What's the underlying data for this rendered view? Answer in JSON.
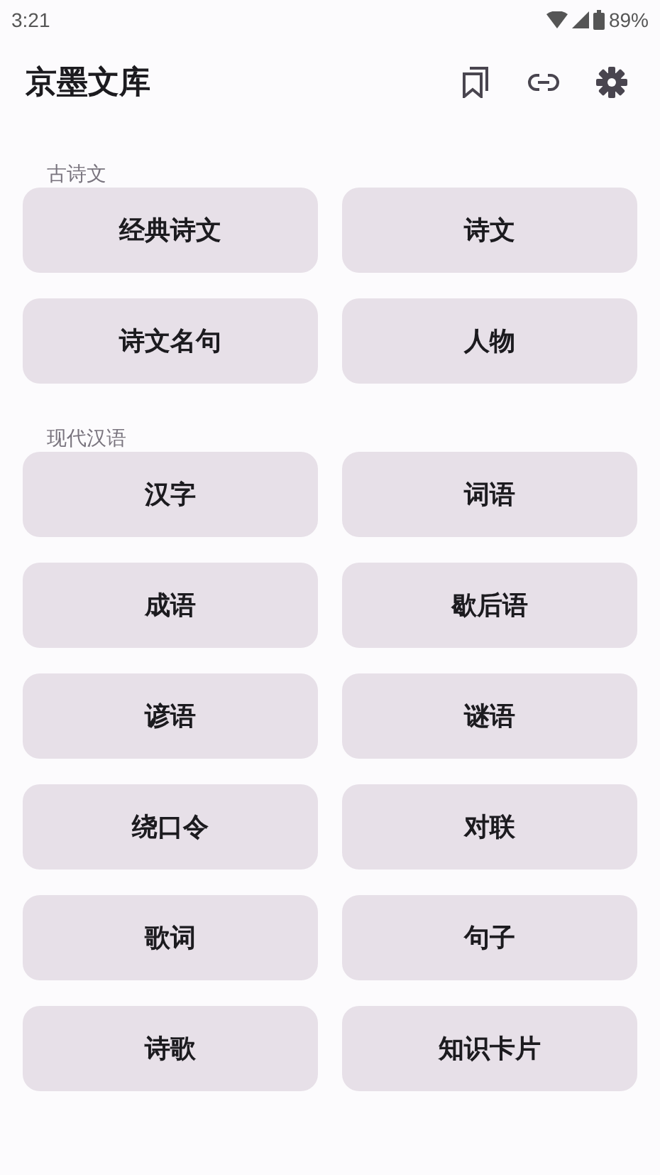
{
  "status_bar": {
    "time": "3:21",
    "battery": "89%"
  },
  "app_bar": {
    "title": "京墨文库"
  },
  "sections": [
    {
      "title": "古诗文",
      "buttons": [
        "经典诗文",
        "诗文",
        "诗文名句",
        "人物"
      ]
    },
    {
      "title": "现代汉语",
      "buttons": [
        "汉字",
        "词语",
        "成语",
        "歇后语",
        "谚语",
        "谜语",
        "绕口令",
        "对联",
        "歌词",
        "句子",
        "诗歌",
        "知识卡片"
      ]
    }
  ]
}
